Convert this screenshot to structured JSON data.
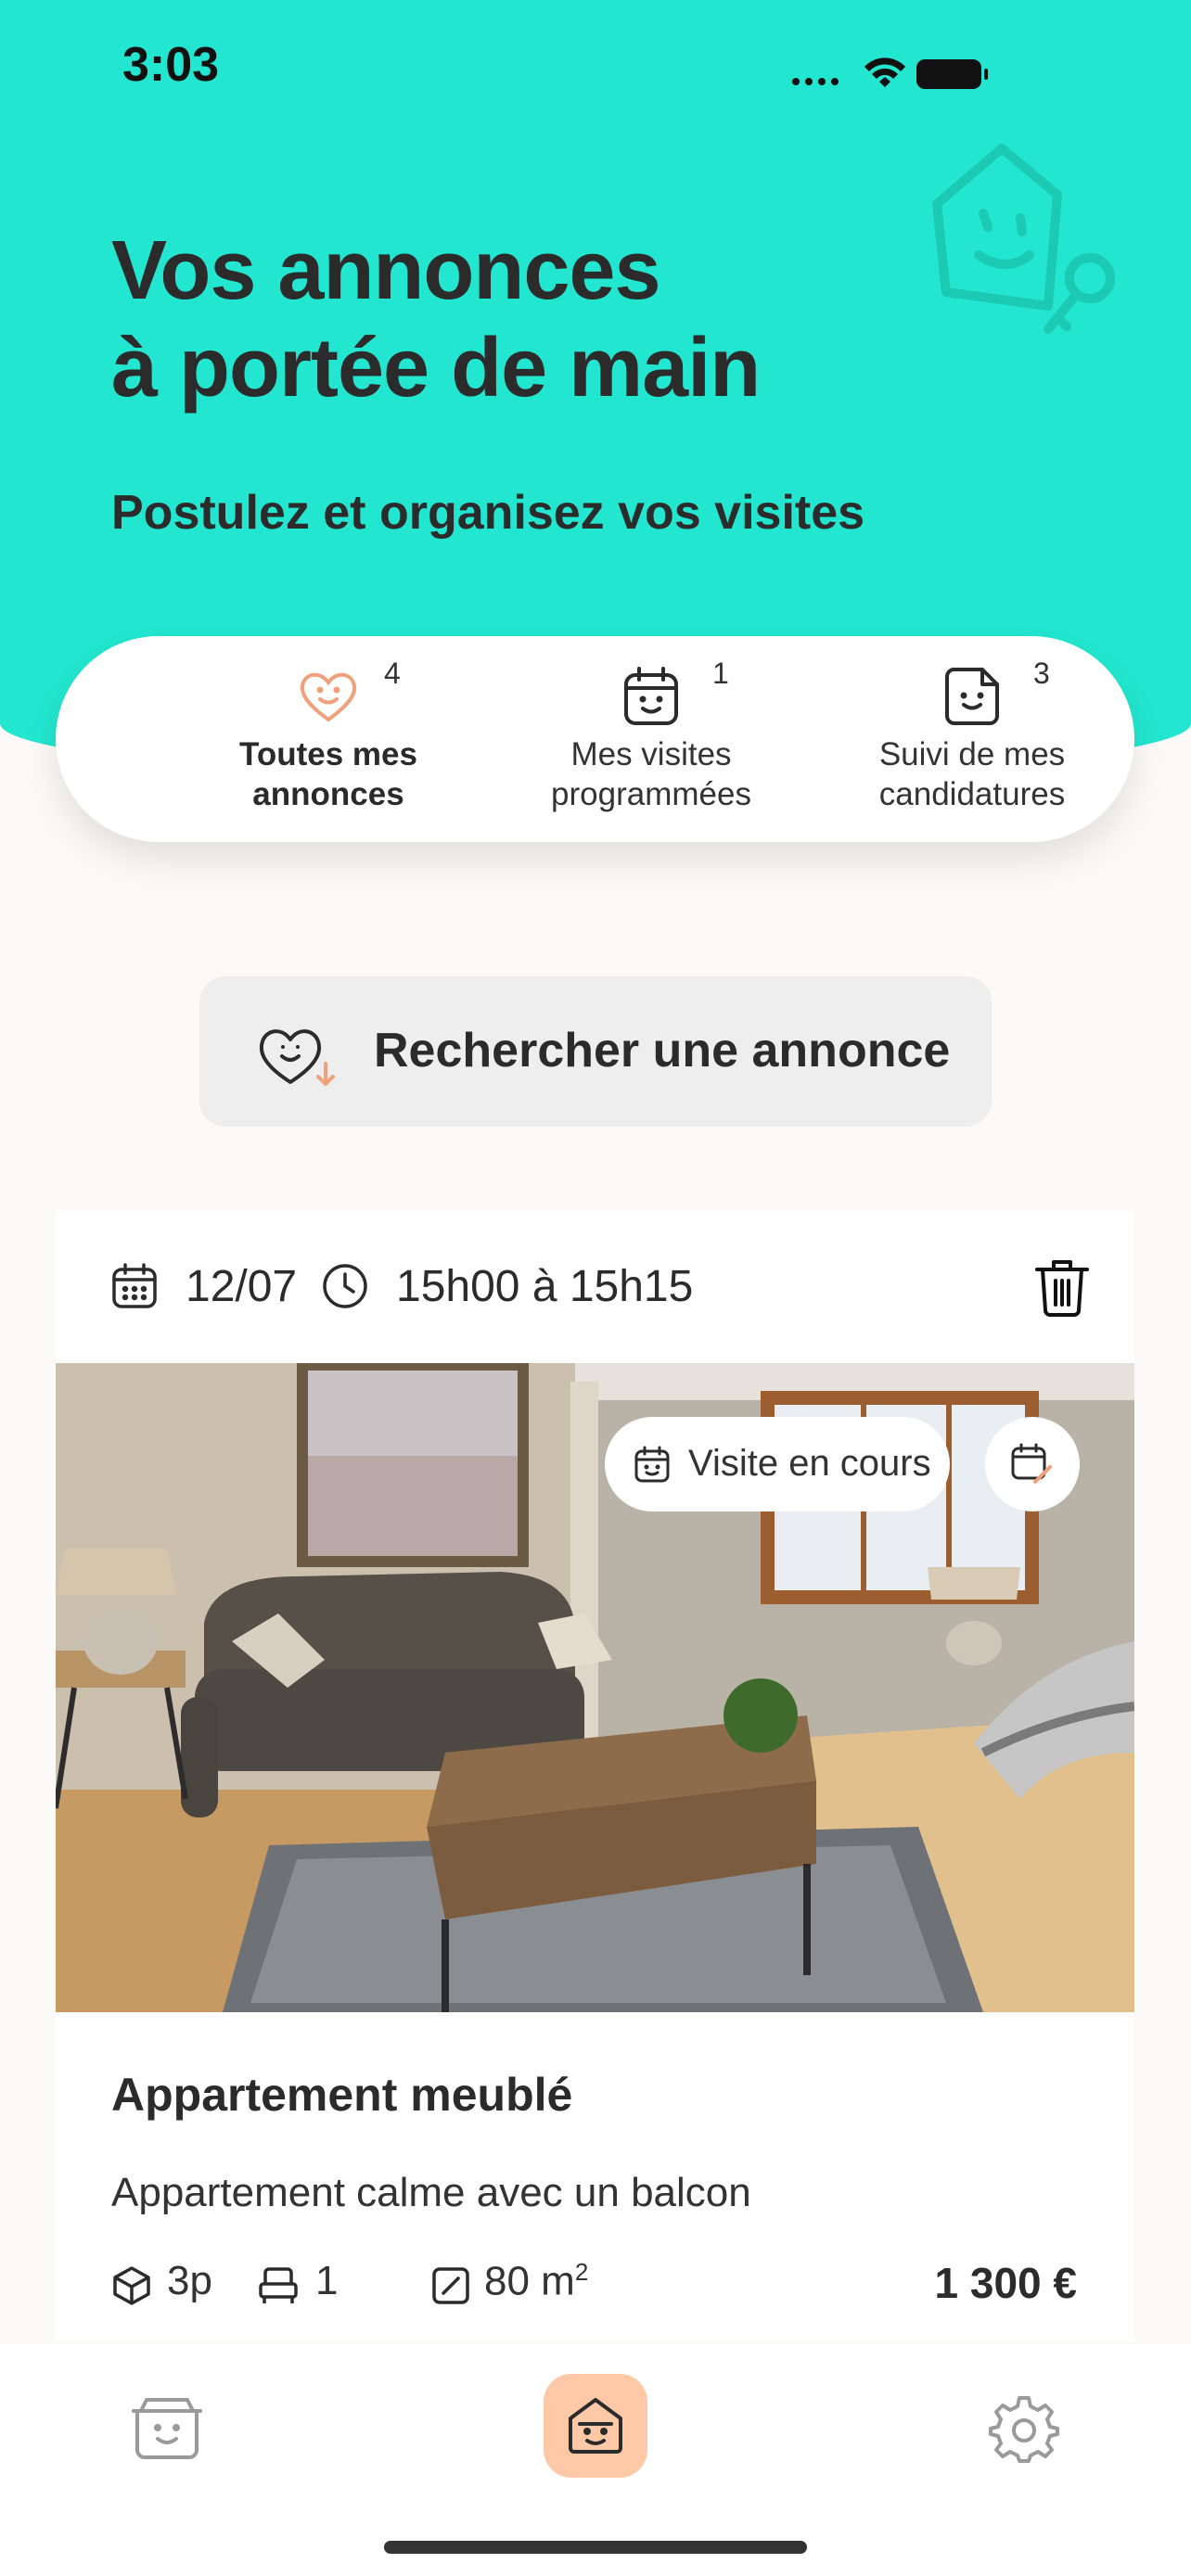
{
  "status_bar": {
    "time": "3:03"
  },
  "hero": {
    "title_line1": "Vos annonces",
    "title_line2": "à portée de main",
    "subtitle": "Postulez et organisez vos visites"
  },
  "tabs": [
    {
      "label_line1": "Toutes mes",
      "label_line2": "annonces",
      "count": "4",
      "icon": "heart-smile-icon",
      "active": true
    },
    {
      "label_line1": "Mes visites",
      "label_line2": "programmées",
      "count": "1",
      "icon": "calendar-smile-icon",
      "active": false
    },
    {
      "label_line1": "Suivi de mes",
      "label_line2": "candidatures",
      "count": "3",
      "icon": "document-smile-icon",
      "active": false
    }
  ],
  "search_button": {
    "label": "Rechercher une annonce",
    "icon": "heart-search-icon"
  },
  "listing": {
    "date": "12/07",
    "time_range": "15h00 à 15h15",
    "status_badge": "Visite en cours",
    "title": "Appartement meublé",
    "description": "Appartement calme avec un balcon",
    "rooms": "3p",
    "bedrooms": "1",
    "area_value": "80 m",
    "area_unit_sup": "2",
    "price": "1 300 €"
  },
  "bottom_nav": {
    "items": [
      "folder-smile-icon",
      "home-smile-icon",
      "settings-gear-icon"
    ],
    "active": "home-smile-icon"
  },
  "colors": {
    "accent": "#22e6cf",
    "highlight": "#ffc9a8",
    "heart": "#f0a07a"
  }
}
